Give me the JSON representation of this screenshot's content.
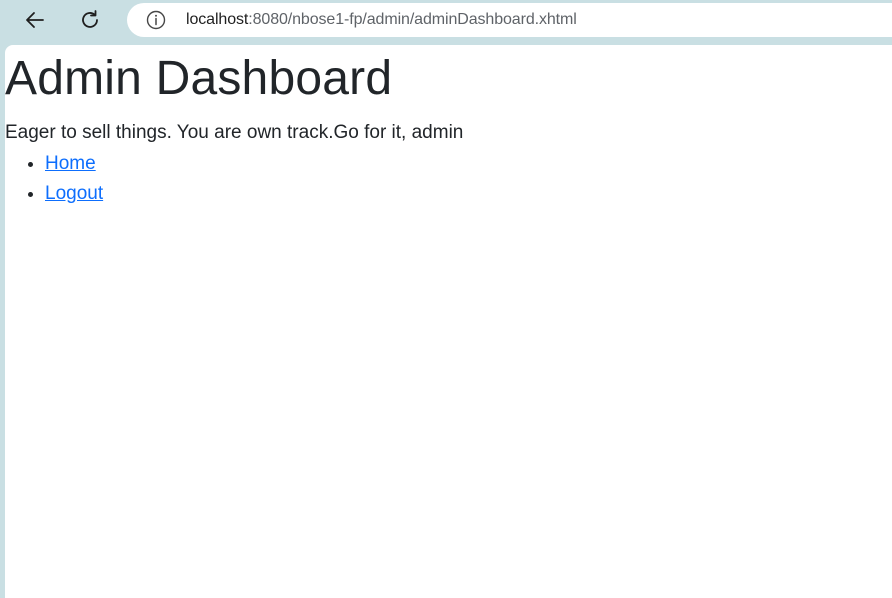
{
  "browser": {
    "url_host": "localhost",
    "url_rest": ":8080/nbose1-fp/admin/adminDashboard.xhtml",
    "icons": {
      "back": "back-arrow-icon",
      "reload": "reload-icon",
      "site_info": "info-icon"
    }
  },
  "page": {
    "title": "Admin Dashboard",
    "tagline": "Eager to sell things. You are own track.Go for it, admin",
    "nav": [
      {
        "label": "Home"
      },
      {
        "label": "Logout"
      }
    ]
  },
  "colors": {
    "frame": "#c9dfe3",
    "link": "#0d6efd",
    "text": "#212529"
  }
}
